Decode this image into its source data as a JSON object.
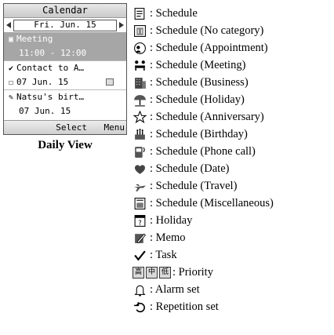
{
  "phone": {
    "title": "Calendar",
    "date": "Fri. Jun. 15",
    "rows": [
      {
        "text": "Meeting",
        "icon": "meeting-icon",
        "selected": true
      },
      {
        "text": "11:00 - 12:00",
        "icon": "",
        "selected": true
      },
      {
        "text": "Contact to A…",
        "icon": "task-check-icon",
        "selected": false
      },
      {
        "text": "07 Jun. 15",
        "icon": "checkbox-icon",
        "selected": false
      },
      {
        "text": "Natsu's birt…",
        "icon": "memo-icon",
        "selected": false
      },
      {
        "text": "07 Jun. 15",
        "icon": "",
        "selected": false
      }
    ],
    "softkey_left": "Select",
    "softkey_right": "Menu"
  },
  "caption": "Daily View",
  "legend": [
    {
      "icon": "schedule-icon",
      "text": ": Schedule"
    },
    {
      "icon": "no-category-icon",
      "text": ": Schedule (No category)"
    },
    {
      "icon": "appointment-icon",
      "text": ": Schedule (Appointment)"
    },
    {
      "icon": "meeting-icon",
      "text": ": Schedule (Meeting)"
    },
    {
      "icon": "business-icon",
      "text": ": Schedule (Business)"
    },
    {
      "icon": "holiday-umbrella-icon",
      "text": ": Schedule (Holiday)"
    },
    {
      "icon": "anniversary-star-icon",
      "text": ": Schedule (Anniversary)"
    },
    {
      "icon": "birthday-cake-icon",
      "text": ": Schedule (Birthday)"
    },
    {
      "icon": "phone-call-icon",
      "text": ": Schedule (Phone call)"
    },
    {
      "icon": "date-heart-icon",
      "text": ": Schedule (Date)"
    },
    {
      "icon": "travel-plane-icon",
      "text": ": Schedule (Travel)"
    },
    {
      "icon": "miscellaneous-icon",
      "text": ": Schedule (Miscellaneous)"
    },
    {
      "icon": "holiday-calendar-icon",
      "text": ": Holiday"
    },
    {
      "icon": "memo-icon",
      "text": ": Memo"
    },
    {
      "icon": "task-check-icon",
      "text": ": Task"
    },
    {
      "icon": "priority-icons",
      "text": ": Priority"
    },
    {
      "icon": "alarm-bell-icon",
      "text": ": Alarm set"
    },
    {
      "icon": "repetition-icon",
      "text": ": Repetition set"
    }
  ]
}
